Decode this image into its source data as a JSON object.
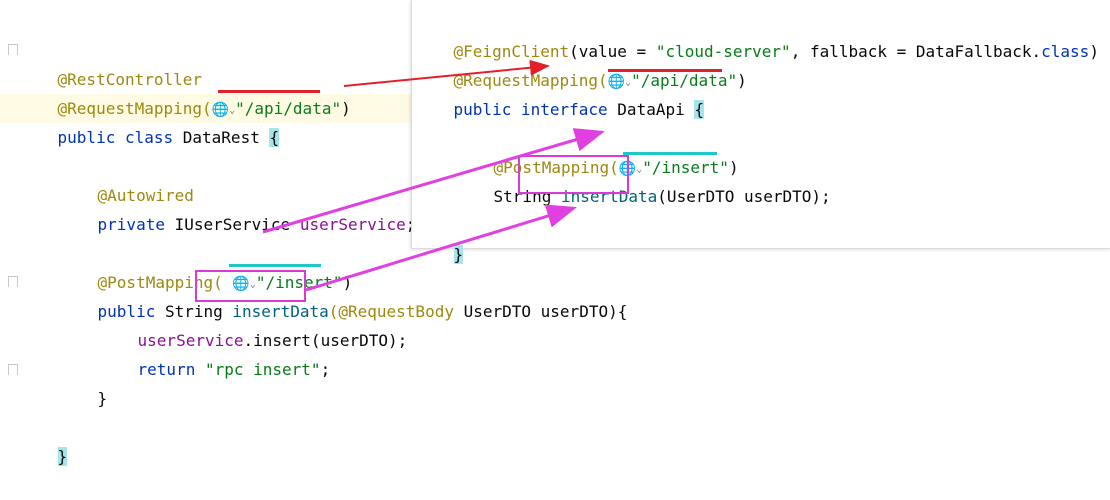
{
  "left_editor": {
    "lines": [
      {
        "ann": "@RestController"
      },
      {
        "ann": "@RequestMapping(",
        "icon": "globe-icon",
        "chevron": "chevron-down-icon",
        "str": "\"/api/data\"",
        "close": ")"
      },
      {
        "kw": "public class ",
        "plain": "DataRest ",
        "brace": "{"
      },
      {
        "ann": "@Autowired"
      },
      {
        "kw": "private ",
        "plain": "IUserService ",
        "field": "userService",
        "tail": ";"
      },
      {
        "ann": "@PostMapping( ",
        "icon": "globe-icon",
        "chevron": "chevron-down-icon",
        "str": "\"/insert\"",
        "close": ")"
      },
      {
        "kw": "public ",
        "plain": "String ",
        "method": "insertData",
        "ann2": "(@RequestBody ",
        "plain2": "UserDTO userDTO){"
      },
      {
        "field": "userService",
        "plain": ".insert(userDTO);"
      },
      {
        "kw": "return ",
        "str": "\"rpc insert\"",
        "tail": ";"
      },
      {
        "plain": "}"
      },
      {
        "brace": "}"
      }
    ]
  },
  "popup_editor": {
    "lines": [
      {
        "ann": "@FeignClient",
        "plain": "(value = ",
        "str": "\"cloud-server\"",
        "plain2": ", fallback = DataFallback.",
        "kw": "class",
        "close": ")"
      },
      {
        "ann": "@RequestMapping(",
        "icon": "globe-icon",
        "chevron": "chevron-down-icon",
        "str": "\"/api/data\"",
        "close": ")"
      },
      {
        "kw": "public interface ",
        "plain": "DataApi ",
        "brace": "{"
      },
      {
        "ann": "@PostMapping(",
        "icon": "globe-icon",
        "chevron": "chevron-down-icon",
        "str": "\"/insert\"",
        "close": ")"
      },
      {
        "plain": "String ",
        "method": "insertData",
        "plain2": "(UserDTO userDTO);"
      },
      {
        "brace": "}"
      }
    ]
  },
  "glyphs": {
    "globe": "🌐",
    "chevron": "⌄"
  },
  "colors": {
    "annotation": "#9e880d",
    "keyword": "#0033b3",
    "string": "#067d17",
    "field": "#871094",
    "arrow_red": "#e2202a",
    "arrow_magenta": "#e040e0",
    "underline_cyan": "#1ec8c8"
  }
}
